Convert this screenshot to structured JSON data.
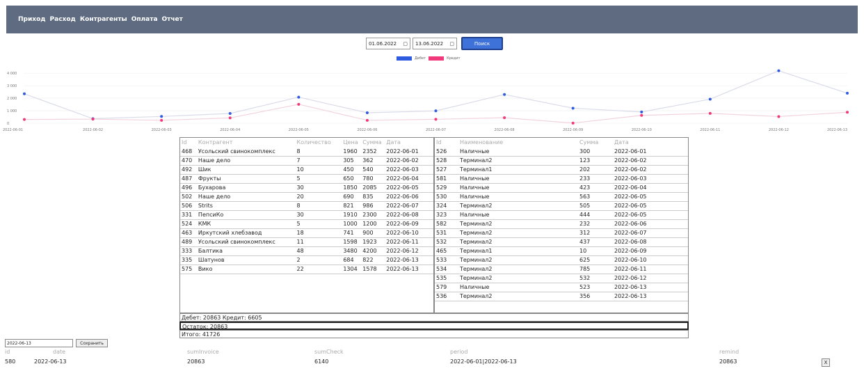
{
  "nav": {
    "items": [
      "Приход",
      "Расход",
      "Контрагенты",
      "Оплата",
      "Отчет"
    ]
  },
  "search": {
    "from": "01.06.2022",
    "to": "13.06.2022",
    "button": "Поиск"
  },
  "chart_data": {
    "type": "line",
    "x": [
      "2022-06-01",
      "2022-06-02",
      "2022-06-03",
      "2022-06-04",
      "2022-06-05",
      "2022-06-06",
      "2022-06-07",
      "2022-06-08",
      "2022-06-09",
      "2022-06-10",
      "2022-06-11",
      "2022-06-12",
      "2022-06-13"
    ],
    "series": [
      {
        "name": "Дебет",
        "color": "#2f5be0",
        "values": [
          2352,
          362,
          540,
          780,
          2085,
          835,
          986,
          2300,
          1200,
          900,
          1923,
          4200,
          2400
        ]
      },
      {
        "name": "Кредит",
        "color": "#f0387a",
        "values": [
          300,
          325,
          233,
          423,
          1512,
          232,
          312,
          437,
          10,
          625,
          785,
          532,
          879
        ]
      }
    ],
    "yticks": [
      "0",
      "1 000",
      "2 000",
      "3 000",
      "4 000"
    ],
    "ylim": [
      0,
      4400
    ],
    "legend": "top-center"
  },
  "left_table": {
    "headers": [
      "Id",
      "Контрагент",
      "Количество",
      "Цена",
      "Сумма",
      "Дата"
    ],
    "rows": [
      [
        "468",
        "Усольский свинокомплекс",
        "8",
        "1960",
        "2352",
        "2022-06-01"
      ],
      [
        "470",
        "Наше дело",
        "7",
        "305",
        "362",
        "2022-06-02"
      ],
      [
        "492",
        "Шик",
        "10",
        "450",
        "540",
        "2022-06-03"
      ],
      [
        "487",
        "Фрукты",
        "5",
        "650",
        "780",
        "2022-06-04"
      ],
      [
        "496",
        "Бухарова",
        "30",
        "1850",
        "2085",
        "2022-06-05"
      ],
      [
        "502",
        "Наше дело",
        "20",
        "690",
        "835",
        "2022-06-06"
      ],
      [
        "506",
        "Strits",
        "8",
        "821",
        "986",
        "2022-06-07"
      ],
      [
        "331",
        "ПепсиКо",
        "30",
        "1910",
        "2300",
        "2022-06-08"
      ],
      [
        "524",
        "КМК",
        "5",
        "1000",
        "1200",
        "2022-06-09"
      ],
      [
        "463",
        "Иркутский хлебзавод",
        "18",
        "741",
        "900",
        "2022-06-10"
      ],
      [
        "489",
        "Усольский свинокомплекс",
        "11",
        "1598",
        "1923",
        "2022-06-11"
      ],
      [
        "333",
        "Балтика",
        "48",
        "3480",
        "4200",
        "2022-06-12"
      ],
      [
        "335",
        "Шатунов",
        "2",
        "684",
        "822",
        "2022-06-13"
      ],
      [
        "575",
        "Вико",
        "22",
        "1304",
        "1578",
        "2022-06-13"
      ]
    ]
  },
  "right_table": {
    "headers": [
      "Id",
      "Наименование",
      "Сумма",
      "Дата"
    ],
    "rows": [
      [
        "526",
        "Наличные",
        "300",
        "2022-06-01"
      ],
      [
        "528",
        "Терминал2",
        "123",
        "2022-06-02"
      ],
      [
        "527",
        "Терминал1",
        "202",
        "2022-06-02"
      ],
      [
        "581",
        "Наличные",
        "233",
        "2022-06-03"
      ],
      [
        "529",
        "Наличные",
        "423",
        "2022-06-04"
      ],
      [
        "530",
        "Наличные",
        "563",
        "2022-06-05"
      ],
      [
        "324",
        "Терминал2",
        "505",
        "2022-06-05"
      ],
      [
        "323",
        "Наличные",
        "444",
        "2022-06-05"
      ],
      [
        "582",
        "Терминал2",
        "232",
        "2022-06-06"
      ],
      [
        "531",
        "Терминал2",
        "312",
        "2022-06-07"
      ],
      [
        "532",
        "Терминал2",
        "437",
        "2022-06-08"
      ],
      [
        "465",
        "Терминал1",
        "10",
        "2022-06-09"
      ],
      [
        "533",
        "Терминал2",
        "625",
        "2022-06-10"
      ],
      [
        "534",
        "Терминал2",
        "785",
        "2022-06-11"
      ],
      [
        "535",
        "Терминал2",
        "532",
        "2022-06-12"
      ],
      [
        "579",
        "Наличные",
        "523",
        "2022-06-13"
      ],
      [
        "536",
        "Терминал2",
        "356",
        "2022-06-13"
      ]
    ]
  },
  "summary": {
    "debit_credit": "Дебет: 20863 Кредит: 6605",
    "balance": "Остаток: 20863",
    "total": "Итого: 41726"
  },
  "save": {
    "value": "2022-06-13",
    "button": "Сохранить"
  },
  "bottom": {
    "headers": [
      "id",
      "date",
      "sumInvoice",
      "sumCheck",
      "period",
      "remind"
    ],
    "row": [
      "580",
      "2022-06-13",
      "20863",
      "6140",
      "2022-06-01|2022-06-13",
      "20863"
    ],
    "delete": "X"
  }
}
